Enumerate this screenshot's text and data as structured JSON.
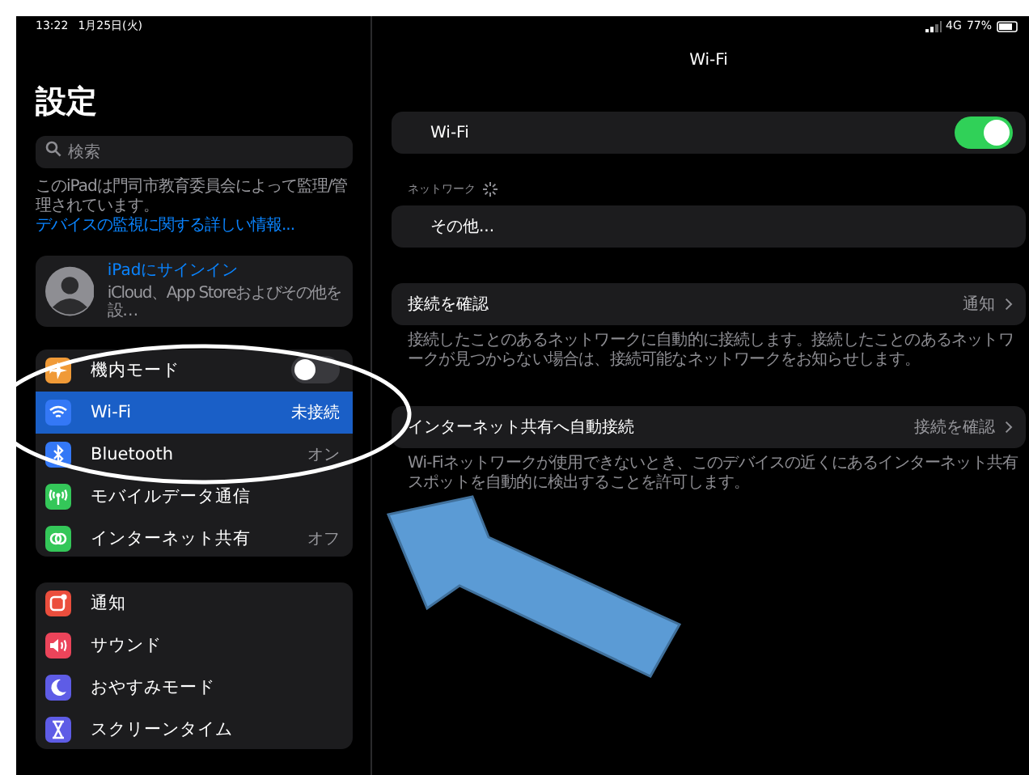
{
  "status_bar": {
    "time": "13:22",
    "date": "1月25日(火)",
    "network": "4G",
    "battery": "77%"
  },
  "sidebar": {
    "title": "設定",
    "search": {
      "placeholder": "検索"
    },
    "managed_note": {
      "text": "このiPadは門司市教育委員会によって監理/管理されています。",
      "link": "デバイスの監視に関する詳しい情報..."
    },
    "account": {
      "title": "iPadにサインイン",
      "subtitle": "iCloud、App Storeおよびその他を設…"
    },
    "groups": [
      [
        {
          "kind": "airplane",
          "color": "#f09a37",
          "label": "機内モード",
          "on": false,
          "selected": false
        },
        {
          "kind": "wifi",
          "color": "#3478f6",
          "label": "Wi-Fi",
          "value": "未接続",
          "selected": true
        },
        {
          "kind": "bluetooth",
          "color": "#3478f6",
          "label": "Bluetooth",
          "value": "オン",
          "selected": false
        },
        {
          "kind": "antenna",
          "color": "#34c759",
          "label": "モバイルデータ通信",
          "selected": false
        },
        {
          "kind": "link",
          "color": "#34c759",
          "label": "インターネット共有",
          "value": "オフ",
          "selected": false
        }
      ],
      [
        {
          "kind": "bell",
          "color": "#eb4e3d",
          "label": "通知",
          "selected": false
        },
        {
          "kind": "speaker",
          "color": "#eb445a",
          "label": "サウンド",
          "selected": false
        },
        {
          "kind": "moon",
          "color": "#5e5ce6",
          "label": "おやすみモード",
          "selected": false
        },
        {
          "kind": "hourglass",
          "color": "#5e5ce6",
          "label": "スクリーンタイム",
          "selected": false
        }
      ]
    ]
  },
  "detail": {
    "title": "Wi-Fi",
    "wifi_row": {
      "label": "Wi-Fi",
      "on": true
    },
    "networks_header": "ネットワーク",
    "other_row": "その他...",
    "ask_row": {
      "label": "接続を確認",
      "value": "通知",
      "footer": "接続したことのあるネットワークに自動的に接続します。接続したことのあるネットワークが見つからない場合は、接続可能なネットワークをお知らせします。"
    },
    "hotspot_row": {
      "label": "インターネット共有へ自動接続",
      "value": "接続を確認",
      "footer": "Wi-Fiネットワークが使用できないとき、このデバイスの近くにあるインターネット共有スポットを自動的に検出することを許可します。"
    }
  }
}
